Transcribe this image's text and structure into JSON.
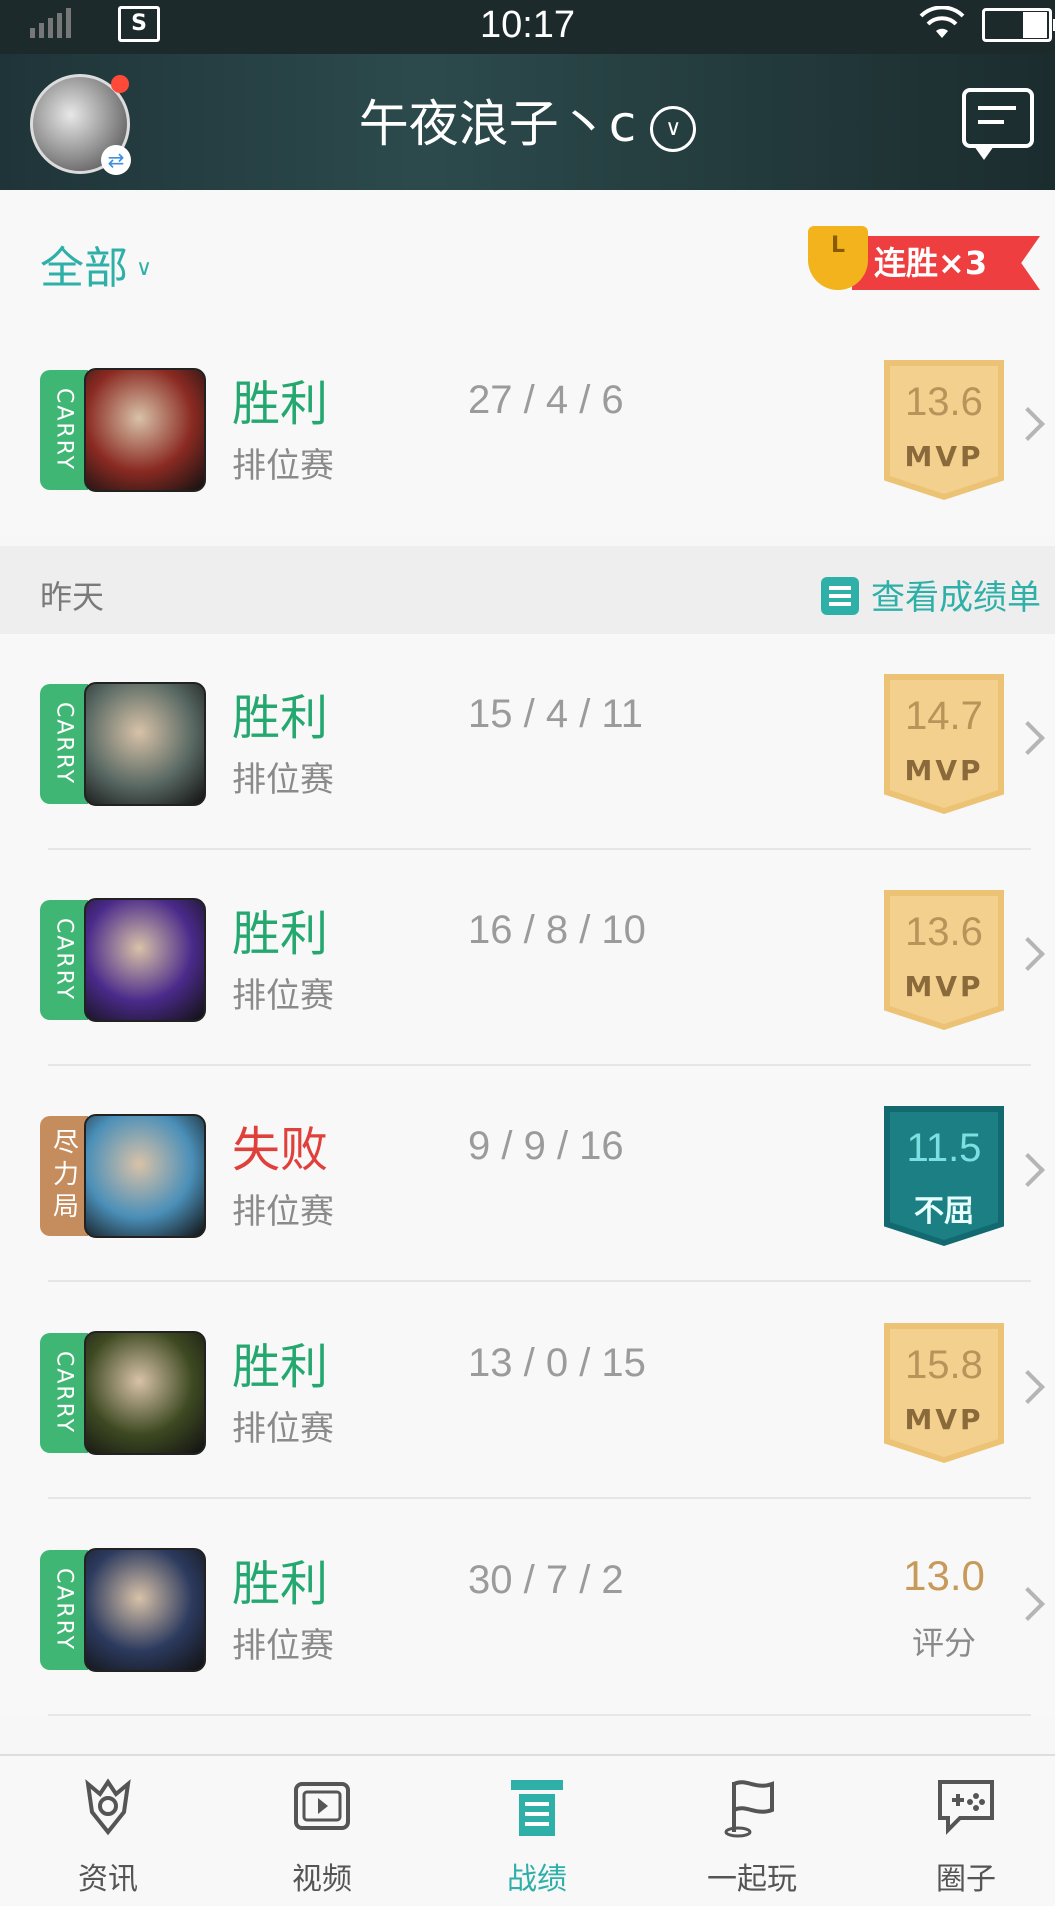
{
  "status_bar": {
    "time": "10:17"
  },
  "header": {
    "username": "午夜浪子丶c"
  },
  "filter": {
    "label": "全部"
  },
  "streak": {
    "text": "连胜×3",
    "cup_letter": "L"
  },
  "day_section": {
    "label": "昨天",
    "report_link": "查看成绩单"
  },
  "matches": [
    {
      "tag": "CARRY",
      "tag_type": "carry",
      "result": "胜利",
      "result_type": "win",
      "mode": "排位赛",
      "kda": "27 / 4 / 6",
      "score": "13.6",
      "badge_label": "MVP",
      "badge_type": "mvp",
      "champ_color": "#8a2a22"
    },
    {
      "tag": "CARRY",
      "tag_type": "carry",
      "result": "胜利",
      "result_type": "win",
      "mode": "排位赛",
      "kda": "15 / 4 / 11",
      "score": "14.7",
      "badge_label": "MVP",
      "badge_type": "mvp",
      "champ_color": "#5a6a64"
    },
    {
      "tag": "CARRY",
      "tag_type": "carry",
      "result": "胜利",
      "result_type": "win",
      "mode": "排位赛",
      "kda": "16 / 8 / 10",
      "score": "13.6",
      "badge_label": "MVP",
      "badge_type": "mvp",
      "champ_color": "#4a2a8a"
    },
    {
      "tag": "尽力局",
      "tag_type": "effort",
      "result": "失败",
      "result_type": "loss",
      "mode": "排位赛",
      "kda": "9 / 9 / 16",
      "score": "11.5",
      "badge_label": "不屈",
      "badge_type": "bq",
      "champ_color": "#4a8fb8"
    },
    {
      "tag": "CARRY",
      "tag_type": "carry",
      "result": "胜利",
      "result_type": "win",
      "mode": "排位赛",
      "kda": "13 / 0 / 15",
      "score": "15.8",
      "badge_label": "MVP",
      "badge_type": "mvp",
      "champ_color": "#3e4a22"
    },
    {
      "tag": "CARRY",
      "tag_type": "carry",
      "result": "胜利",
      "result_type": "win",
      "mode": "排位赛",
      "kda": "30 / 7 / 2",
      "score": "13.0",
      "badge_label": "评分",
      "badge_type": "plain",
      "champ_color": "#2c3a5e"
    }
  ],
  "tabs": [
    {
      "label": "资讯",
      "icon": "news-icon",
      "active": false
    },
    {
      "label": "视频",
      "icon": "video-icon",
      "active": false
    },
    {
      "label": "战绩",
      "icon": "record-icon",
      "active": true
    },
    {
      "label": "一起玩",
      "icon": "flag-icon",
      "active": false
    },
    {
      "label": "圈子",
      "icon": "chat-gamepad-icon",
      "active": false
    }
  ],
  "colors": {
    "accent": "#2eb0a8",
    "win": "#25a870",
    "loss": "#e0403b",
    "carry_tag": "#3fb673",
    "effort_tag": "#c58d5e",
    "mvp_badge": "#f3d08d",
    "bq_badge": "#1b7f83"
  }
}
